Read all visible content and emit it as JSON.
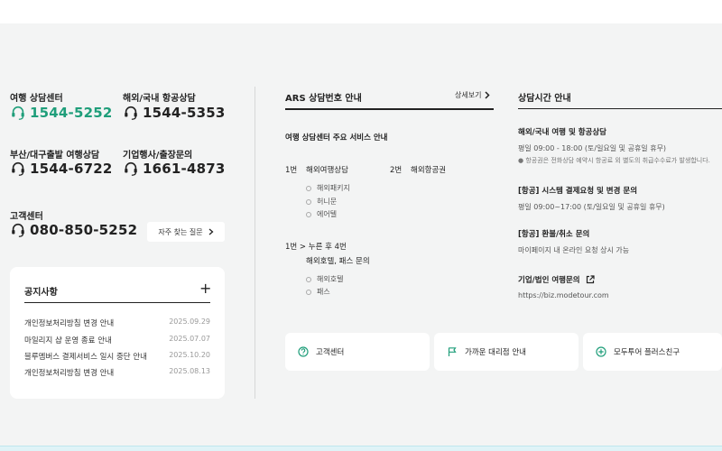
{
  "contacts": [
    {
      "label": "여행 상담센터",
      "number": "1544-5252"
    },
    {
      "label": "해외/국내 항공상담",
      "number": "1544-5353"
    },
    {
      "label": "부산/대구출발 여행상담",
      "number": "1544-6722"
    },
    {
      "label": "기업행사/출장문의",
      "number": "1661-4873"
    },
    {
      "label": "고객센터",
      "number": "080-850-5252"
    }
  ],
  "faq_label": "자주 찾는 질문",
  "notice": {
    "title": "공지사항",
    "plus": "+",
    "items": [
      {
        "text": "개인정보처리방침 변경 안내",
        "date": "2025.09.29"
      },
      {
        "text": "마일리지 샵 운영 종료 안내",
        "date": "2025.07.07"
      },
      {
        "text": "블루멤버스 결제서비스 일시 중단 안내",
        "date": "2025.10.20"
      },
      {
        "text": "개인정보처리방침 변경 안내",
        "date": "2025.08.13"
      }
    ]
  },
  "ars": {
    "title": "ARS 상담번호 안내",
    "more": "상세보기",
    "subtitle": "여행 상담센터 주요 서비스 안내",
    "menu1_key": "1번",
    "menu1_name": "해외여행상담",
    "menu1_items": [
      "해외패키지",
      "허니문",
      "에어텔"
    ],
    "menu2_key": "2번",
    "menu2_name": "해외항공권",
    "menu3_key": "1번 > 누른 후 4번",
    "menu3_name": "해외호텔, 패스 문의",
    "menu3_items": [
      "해외호텔",
      "패스"
    ]
  },
  "hours": {
    "title": "상담시간 안내",
    "sections": [
      {
        "head": "해외/국내 여행 및 항공상담",
        "text": "평일 09:00 - 18:00 (토/일요일 및 공휴일 휴무)",
        "note": "● 항공권은 전화상담 예약시 항공료 외 별도의 취급수수료가 발생합니다."
      },
      {
        "head": "[항공] 시스템 결제요청 및 변경 문의",
        "text": "평일 09:00~17:00 (토/일요일 및 공휴일 휴무)"
      },
      {
        "head": "[항공] 환불/취소 문의",
        "text": "마이페이지 내 온라인 요청 상시 가능"
      }
    ],
    "biz_head": "기업/법인 여행문의",
    "biz_url": "https://biz.modetour.com"
  },
  "cards": [
    {
      "label": "고객센터",
      "icon": "question-circle-icon"
    },
    {
      "label": "가까운 대리점 안내",
      "icon": "flag-icon"
    },
    {
      "label": "모두투어 플러스친구",
      "icon": "plus-circle-icon"
    }
  ],
  "colors": {
    "accent": "#1f9e7a",
    "background": "#f3f4f4"
  }
}
